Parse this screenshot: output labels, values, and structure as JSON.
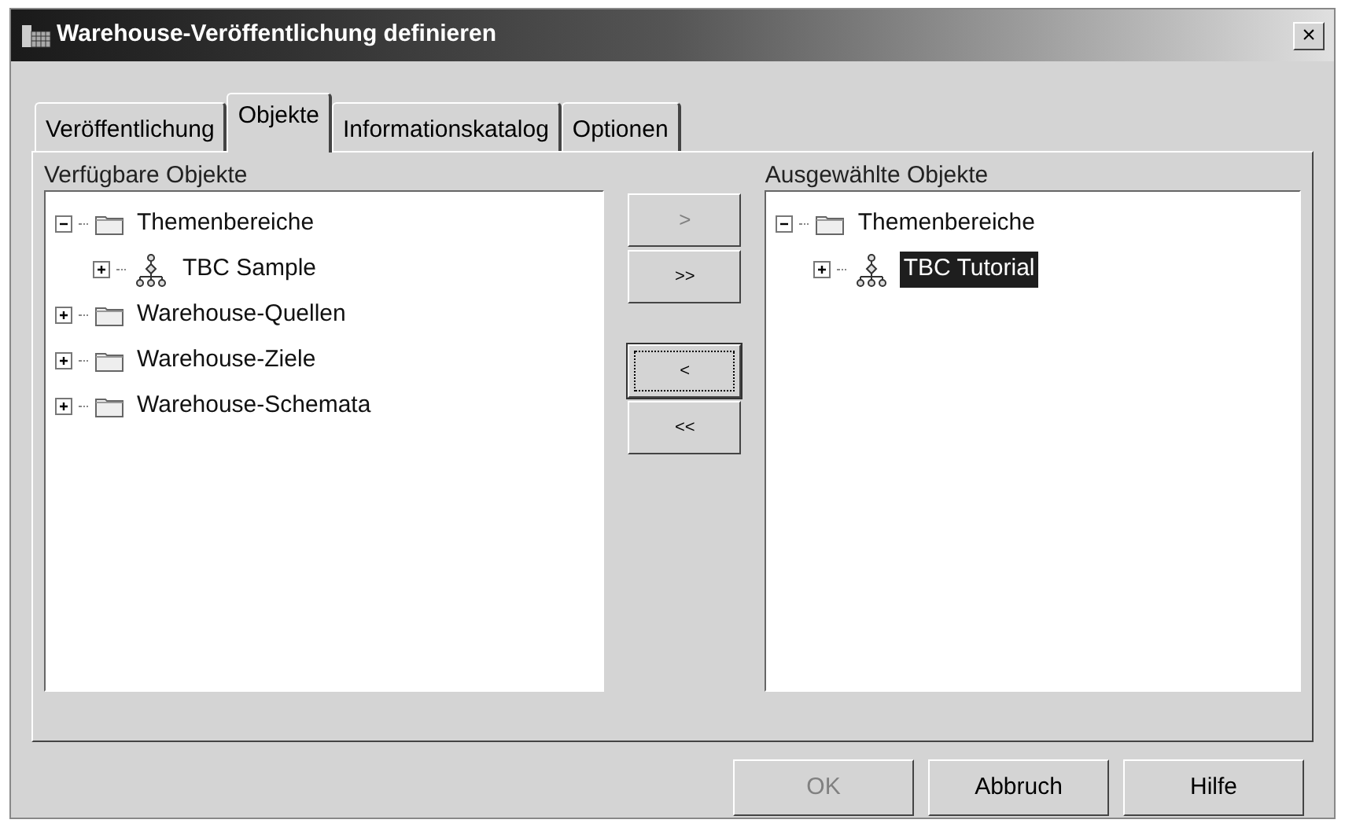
{
  "window": {
    "title": "Warehouse-Veröffentlichung definieren",
    "close": "×"
  },
  "tabs": [
    {
      "label": "Veröffentlichung",
      "selected": false
    },
    {
      "label": "Objekte",
      "selected": true
    },
    {
      "label": "Informationskatalog",
      "selected": false
    },
    {
      "label": "Optionen",
      "selected": false
    }
  ],
  "available": {
    "label": "Verfügbare Objekte",
    "tree": [
      {
        "label": "Themenbereiche",
        "kind": "folder",
        "expanded": true,
        "selected": false,
        "children": [
          {
            "label": "TBC Sample",
            "kind": "model",
            "expanded": false,
            "selected": false
          }
        ]
      },
      {
        "label": "Warehouse-Quellen",
        "kind": "folder",
        "expanded": false,
        "selected": false
      },
      {
        "label": "Warehouse-Ziele",
        "kind": "folder",
        "expanded": false,
        "selected": false
      },
      {
        "label": "Warehouse-Schemata",
        "kind": "folder",
        "expanded": false,
        "selected": false
      }
    ]
  },
  "move_buttons": [
    {
      "label": ">",
      "disabled": true,
      "focused": false
    },
    {
      "label": ">>",
      "disabled": false,
      "focused": false
    },
    {
      "label": "<",
      "disabled": false,
      "focused": true
    },
    {
      "label": "<<",
      "disabled": false,
      "focused": false
    }
  ],
  "selected_objects": {
    "label": "Ausgewählte Objekte",
    "tree": [
      {
        "label": "Themenbereiche",
        "kind": "folder",
        "expanded": true,
        "selected": false,
        "children": [
          {
            "label": "TBC Tutorial",
            "kind": "model",
            "expanded": false,
            "selected": true
          }
        ]
      }
    ]
  },
  "buttons": [
    {
      "label": "OK",
      "disabled": true
    },
    {
      "label": "Abbruch",
      "disabled": false
    },
    {
      "label": "Hilfe",
      "disabled": false
    }
  ]
}
